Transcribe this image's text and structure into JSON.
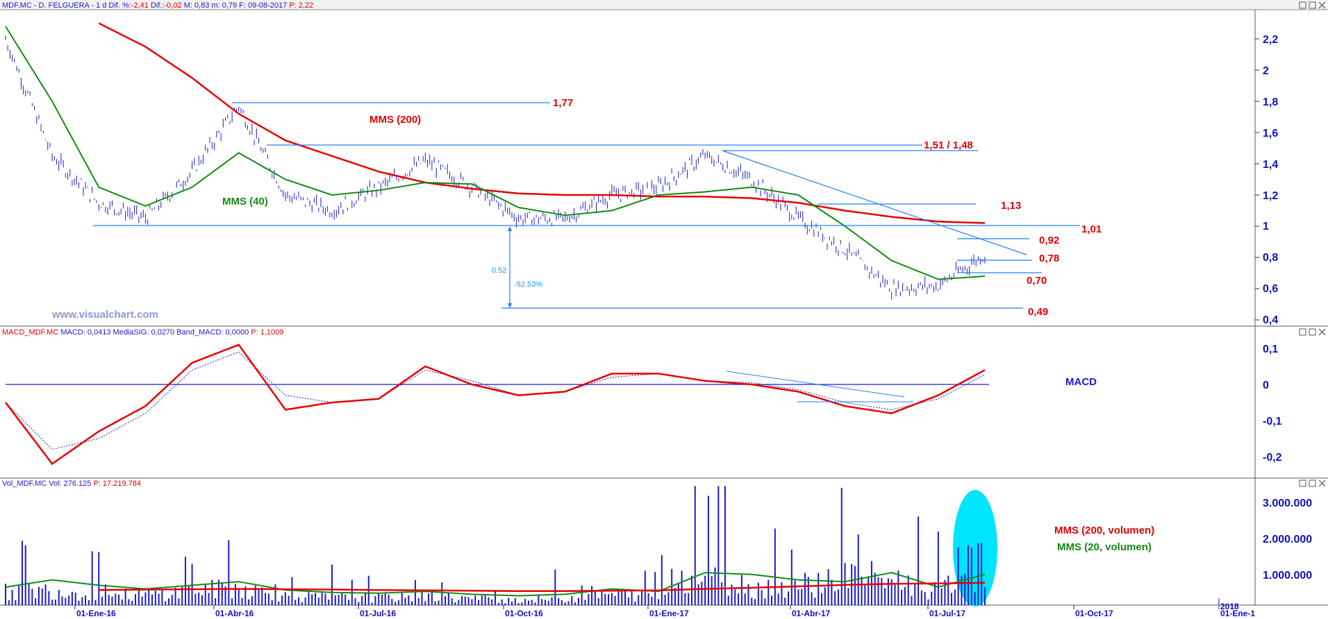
{
  "header": {
    "ticker": "MDF.MC - D. FELGUERA - ",
    "period": "1 d",
    "dif_pct_label": " Dif. %:",
    "dif_pct_value": "-2,41",
    "dif_label": " Dif.:",
    "dif_value": "-0,02",
    "m_label": " M: 0,83",
    "min_label": "  m: 0,79",
    "date_label": "  F: 09-08-2017",
    "p_label": "  P: 2,22"
  },
  "panels": {
    "price": {
      "y_ticks": [
        "2,2",
        "2",
        "1,8",
        "1,6",
        "1,4",
        "1,2",
        "1",
        "0,8",
        "0,6",
        "0,4"
      ],
      "watermark": "www.visualchart.com",
      "legend_mms200": "MMS (200)",
      "legend_mms40": "MMS (40)",
      "levels": [
        "1,77",
        "1,51 / 1,48",
        "1,13",
        "1,01",
        "0,92",
        "0,78",
        "0,70",
        "0,49"
      ],
      "measure_value": "0.52",
      "measure_pct": "-52.53%"
    },
    "macd": {
      "title_a": "MACD_MDF.MC",
      "title_b": "  MACD: 0,0413  MediaSIG: 0,0270  Band_MACD: 0,0000",
      "title_c": "  P: 1,1009",
      "y_ticks": [
        "0,1",
        "0",
        "-0,1",
        "-0,2"
      ],
      "label": "MACD"
    },
    "volume": {
      "title_a": "Vol_MDF.MC",
      "title_b": "  Vol: 276.125",
      "title_c": "  P: 17.219.784",
      "y_ticks": [
        "3.000.000",
        "2.000.000",
        "1.000.000"
      ],
      "legend_mms200": "MMS (200, volumen)",
      "legend_mms20": "MMS (20, volumen)"
    }
  },
  "x_ticks": [
    "01-Ene-16",
    "01-Abr-16",
    "01-Jul-16",
    "01-Oct-16",
    "01-Ene-17",
    "01-Abr-17",
    "01-Jul-17",
    "01-Oct-17",
    "2018",
    "01-Ene-1"
  ],
  "colors": {
    "price_bars": "#1a1ad0",
    "mms200": "#e60000",
    "mms40": "#138a13",
    "trendlines": "#1e80ff",
    "macd_line": "#e60000",
    "macd_signal": "#1a1ad0",
    "highlight": "#00e5ff"
  },
  "chart_data": [
    {
      "type": "line",
      "title": "MDF.MC - D. FELGUERA",
      "xlabel": "",
      "ylabel": "",
      "ylim": [
        0.4,
        2.3
      ],
      "x": [
        "2015-11",
        "2015-12",
        "2016-01",
        "2016-02",
        "2016-03",
        "2016-04",
        "2016-05",
        "2016-06",
        "2016-07",
        "2016-08",
        "2016-09",
        "2016-10",
        "2016-11",
        "2016-12",
        "2017-01",
        "2017-02",
        "2017-03",
        "2017-04",
        "2017-05",
        "2017-06",
        "2017-07",
        "2017-08"
      ],
      "series": [
        {
          "name": "price",
          "values": [
            2.2,
            1.45,
            1.15,
            1.05,
            1.35,
            1.77,
            1.2,
            1.1,
            1.25,
            1.42,
            1.25,
            1.05,
            1.05,
            1.2,
            1.25,
            1.45,
            1.3,
            1.05,
            0.85,
            0.6,
            0.62,
            0.82
          ]
        },
        {
          "name": "MMS (200)",
          "values": [
            null,
            null,
            2.3,
            2.15,
            1.95,
            1.72,
            1.55,
            1.45,
            1.35,
            1.28,
            1.24,
            1.21,
            1.2,
            1.2,
            1.19,
            1.19,
            1.18,
            1.15,
            1.1,
            1.06,
            1.03,
            1.02
          ]
        },
        {
          "name": "MMS (40)",
          "values": [
            2.28,
            1.8,
            1.25,
            1.13,
            1.25,
            1.47,
            1.3,
            1.2,
            1.23,
            1.28,
            1.27,
            1.12,
            1.07,
            1.1,
            1.2,
            1.22,
            1.25,
            1.2,
            1.0,
            0.78,
            0.66,
            0.68
          ]
        }
      ],
      "levels": [
        1.77,
        1.51,
        1.48,
        1.13,
        1.01,
        0.92,
        0.78,
        0.7,
        0.49
      ]
    },
    {
      "type": "line",
      "title": "MACD_MDF.MC",
      "ylim": [
        -0.25,
        0.13
      ],
      "x": [
        "2015-11",
        "2015-12",
        "2016-01",
        "2016-02",
        "2016-03",
        "2016-04",
        "2016-05",
        "2016-06",
        "2016-07",
        "2016-08",
        "2016-09",
        "2016-10",
        "2016-11",
        "2016-12",
        "2017-01",
        "2017-02",
        "2017-03",
        "2017-04",
        "2017-05",
        "2017-06",
        "2017-07",
        "2017-08"
      ],
      "series": [
        {
          "name": "MACD",
          "values": [
            -0.05,
            -0.22,
            -0.13,
            -0.06,
            0.06,
            0.11,
            -0.07,
            -0.05,
            -0.04,
            0.05,
            0.0,
            -0.03,
            -0.02,
            0.03,
            0.03,
            0.01,
            0.0,
            -0.02,
            -0.06,
            -0.08,
            -0.03,
            0.04
          ]
        },
        {
          "name": "MediaSIG",
          "values": [
            -0.05,
            -0.18,
            -0.15,
            -0.08,
            0.04,
            0.09,
            -0.03,
            -0.05,
            -0.04,
            0.04,
            0.01,
            -0.03,
            -0.02,
            0.02,
            0.03,
            0.01,
            0.005,
            -0.015,
            -0.05,
            -0.07,
            -0.04,
            0.027
          ]
        }
      ]
    },
    {
      "type": "bar",
      "title": "Vol_MDF.MC",
      "ylim": [
        0,
        3300000
      ],
      "x": [
        "2015-11",
        "2015-12",
        "2016-01",
        "2016-02",
        "2016-03",
        "2016-04",
        "2016-05",
        "2016-06",
        "2016-07",
        "2016-08",
        "2016-09",
        "2016-10",
        "2016-11",
        "2016-12",
        "2017-01",
        "2017-02",
        "2017-03",
        "2017-04",
        "2017-05",
        "2017-06",
        "2017-07",
        "2017-08"
      ],
      "series": [
        {
          "name": "Vol",
          "values": [
            600000,
            700000,
            500000,
            450000,
            650000,
            800000,
            400000,
            350000,
            350000,
            400000,
            300000,
            250000,
            300000,
            500000,
            400000,
            1500000,
            800000,
            900000,
            1300000,
            1200000,
            600000,
            2000000
          ]
        },
        {
          "name": "MMS (200, volumen)",
          "values": [
            null,
            null,
            420000,
            430000,
            440000,
            450000,
            440000,
            430000,
            420000,
            410000,
            400000,
            390000,
            390000,
            400000,
            410000,
            450000,
            480000,
            520000,
            560000,
            590000,
            600000,
            620000
          ]
        },
        {
          "name": "MMS (20, volumen)",
          "values": [
            500000,
            700000,
            550000,
            450000,
            550000,
            650000,
            420000,
            350000,
            330000,
            380000,
            300000,
            260000,
            300000,
            450000,
            380000,
            900000,
            850000,
            700000,
            650000,
            900000,
            500000,
            850000
          ]
        }
      ]
    }
  ]
}
